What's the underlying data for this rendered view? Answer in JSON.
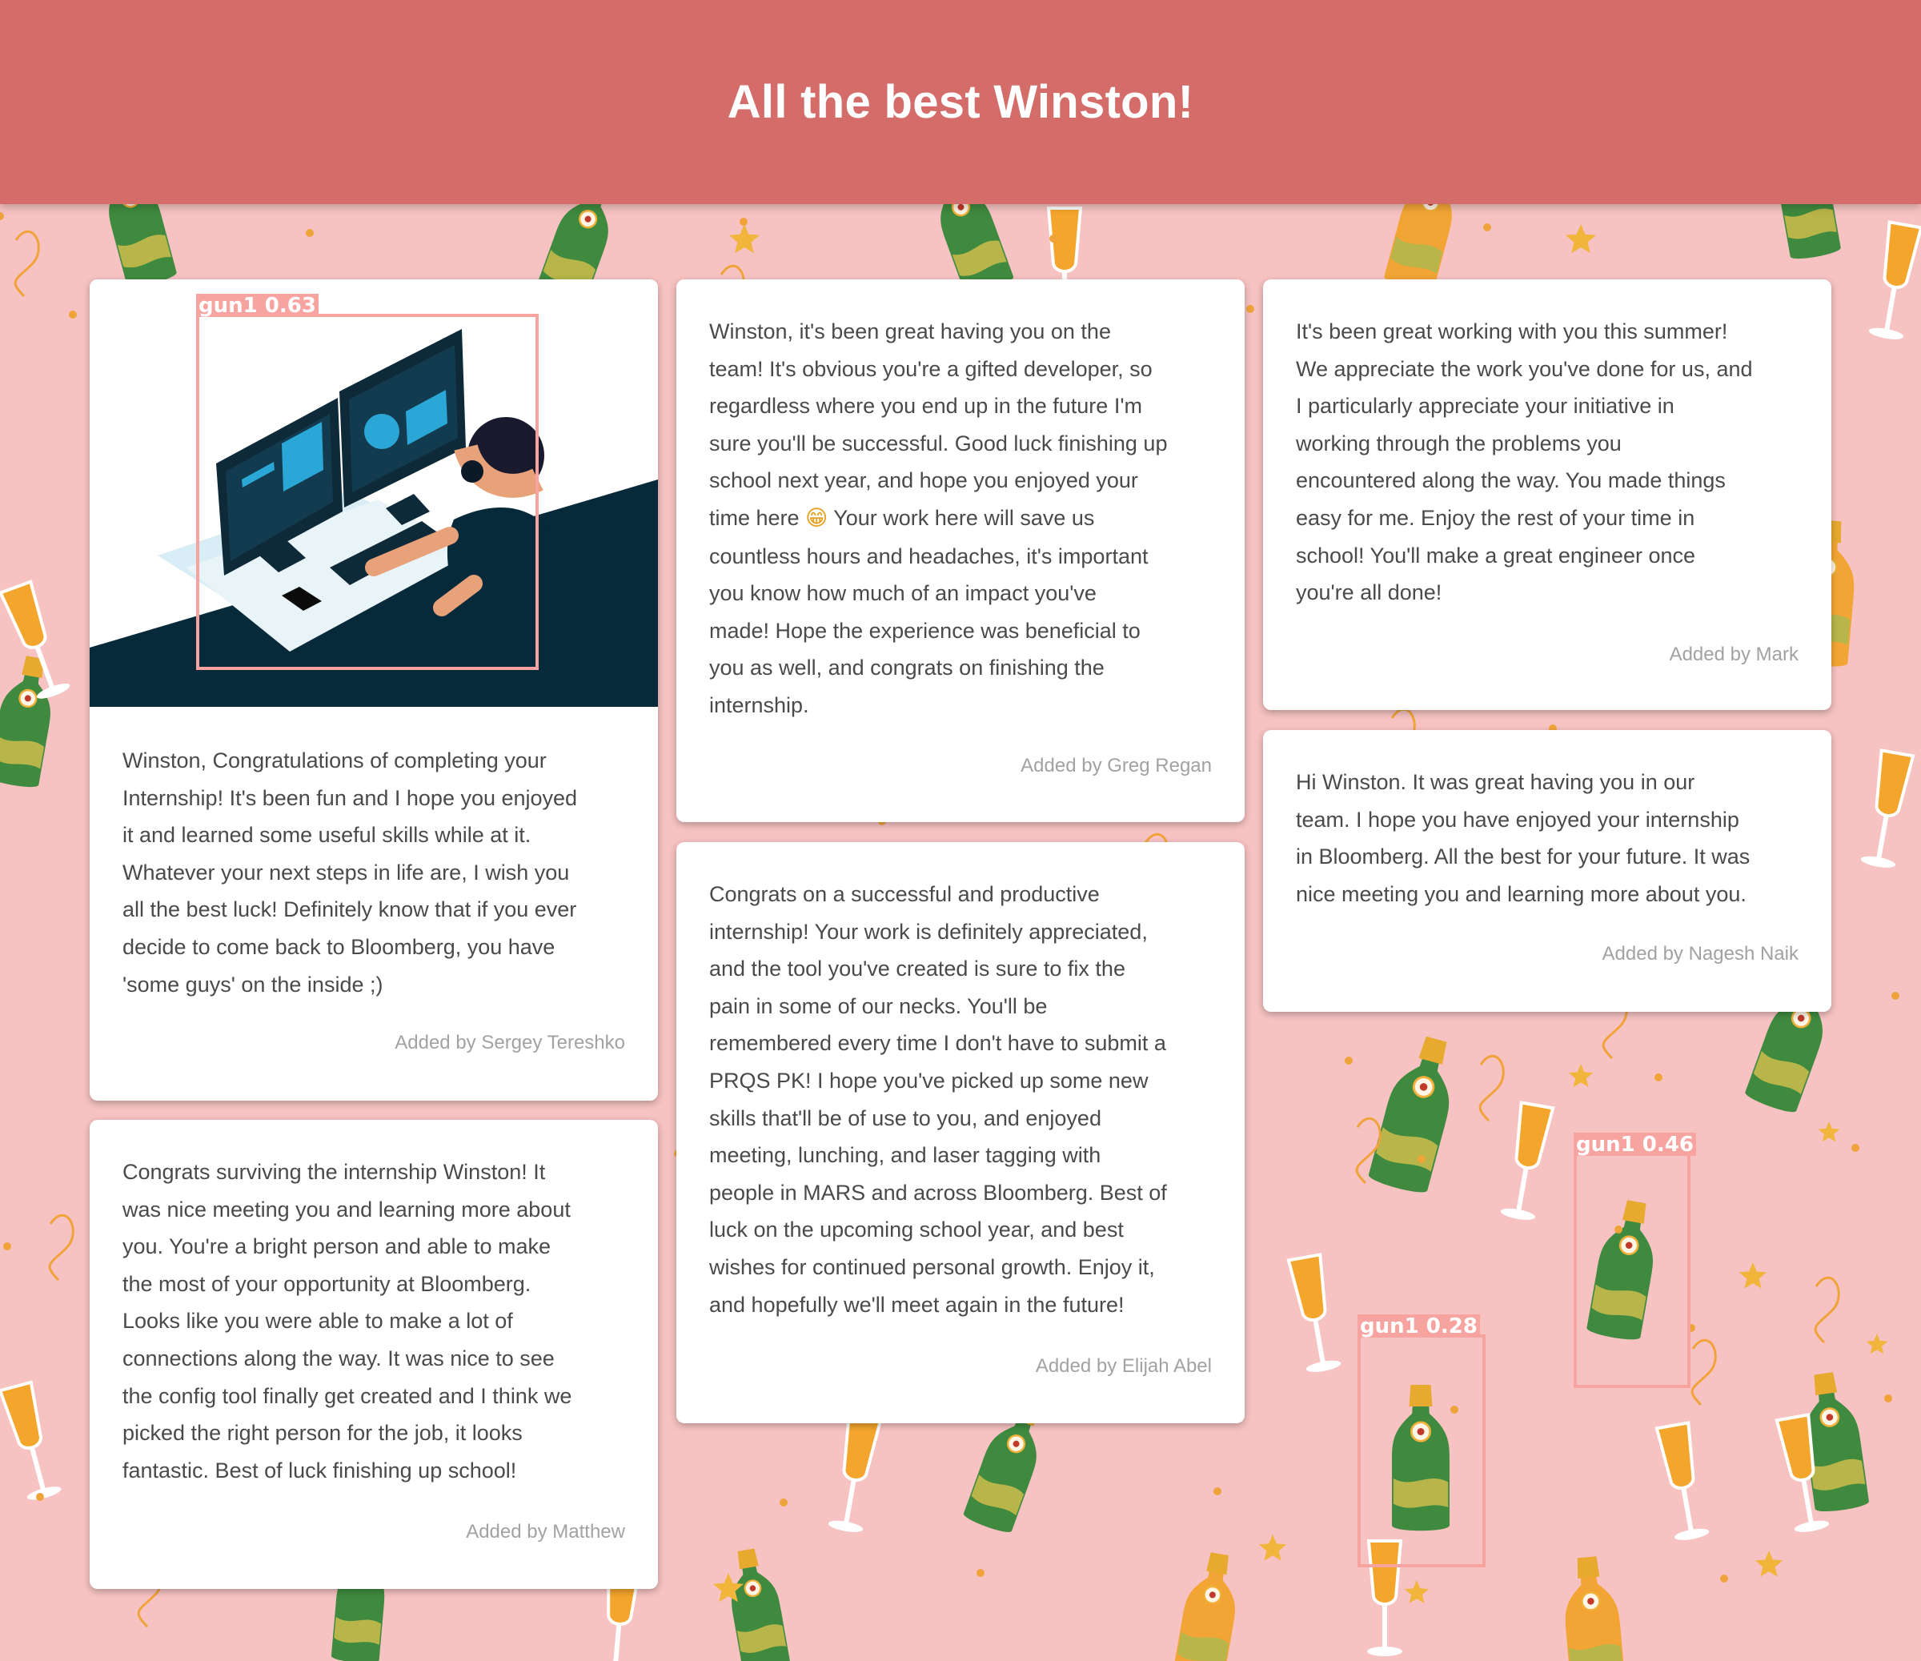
{
  "header": {
    "title": "All the best Winston!"
  },
  "cards": [
    {
      "message": "Winston, Congratulations of completing your\nInternship! It's been fun and I hope you enjoyed\nit and learned some useful skills while at it.\nWhatever your next steps in life are, I wish you\nall the best luck! Definitely know that if you ever\ndecide to come back to Bloomberg, you have\n'some guys' on the inside ;)",
      "author": "Added by Sergey Tereshko"
    },
    {
      "message": "Congrats surviving the internship Winston! It\nwas nice meeting you and learning more about\nyou. You're a bright person and able to make\nthe most of your opportunity at Bloomberg.\nLooks like you were able to make a lot of\nconnections along the way. It was nice to see\nthe config tool finally get created and I think we\npicked the right person for the job, it looks\nfantastic. Best of luck finishing up school!",
      "author": "Added by Matthew"
    },
    {
      "message_before_emoji": "Winston, it's been great having you on the\nteam! It's obvious you're a gifted developer, so\nregardless where you end up in the future I'm\nsure you'll be successful. Good luck finishing up\nschool next year, and hope you enjoyed your\ntime here ",
      "emoji": "😁",
      "message_after_emoji": "  Your work here will save us\ncountless hours and headaches, it's important\nyou know how much of an impact you've\nmade! Hope the experience was beneficial to\nyou as well, and congrats on finishing the\ninternship.",
      "author": "Added by Greg Regan"
    },
    {
      "message": "Congrats on a successful and productive\ninternship! Your work is definitely appreciated,\nand the tool you've created is sure to fix the\npain in some of our necks. You'll be\nremembered every time I don't have to submit a\nPRQS PK! I hope you've picked up some new\nskills that'll be of use to you, and enjoyed\nmeeting, lunching, and laser tagging with\npeople in MARS and across Bloomberg. Best of\nluck on the upcoming school year, and best\nwishes for continued personal growth. Enjoy it,\nand hopefully we'll meet again in the future!",
      "author": "Added by Elijah Abel"
    },
    {
      "message": "It's been great working with you this summer!\nWe appreciate the work you've done for us, and\nI particularly appreciate your initiative in\nworking through the problems you\nencountered along the way. You made things\neasy for me. Enjoy the rest of your time in\nschool! You'll make a great engineer once\nyou're all done!",
      "author": "Added by Mark"
    },
    {
      "message": "Hi Winston. It was great having you in our\nteam. I hope you have enjoyed your internship\nin Bloomberg. All the best for your future. It was\nnice meeting you and learning more about you.",
      "author": "Added by Nagesh Naik"
    }
  ],
  "detections": [
    {
      "label": "gun1  0.63"
    },
    {
      "label": "gun1  0.46"
    },
    {
      "label": "gun1  0.28"
    }
  ],
  "colors": {
    "header": "#d46c69",
    "background": "#f6c2c2",
    "bottle_green": "#3f8a3f",
    "bottle_orange": "#f2a534",
    "detection_box": "#f7a3a0"
  }
}
